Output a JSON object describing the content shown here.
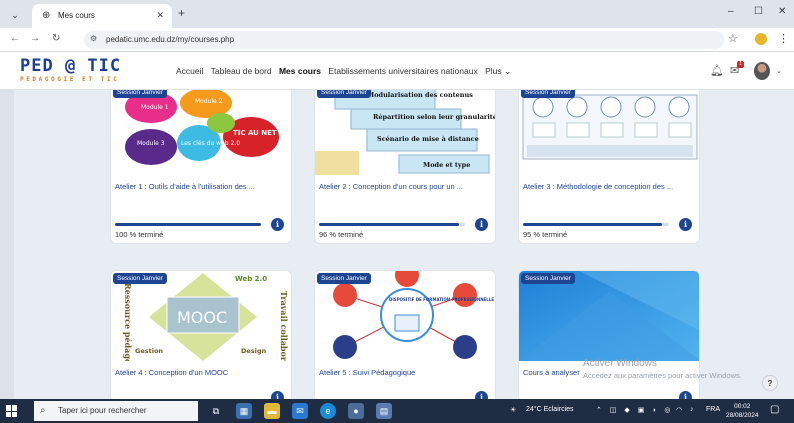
{
  "browser": {
    "tab_title": "Mes cours",
    "url": "pedatic.umc.edu.dz/my/courses.php",
    "new_tab": "+",
    "win_min": "–",
    "win_max": "☐",
    "win_close": "✕"
  },
  "site": {
    "logo_main": "PED @ TIC",
    "logo_sub": "PEDAGOGIE ET TIC",
    "menu": [
      "Accueil",
      "Tableau de bord",
      "Mes cours",
      "Etablissements universitaires nationaux",
      "Plus ⌄"
    ],
    "notif_badge": "1"
  },
  "courses": [
    {
      "session": "Session Janvier",
      "title": "Atelier 1 : Outils d'aide à l'utilisation des ...",
      "progress": 100,
      "progress_label": "100 % terminé"
    },
    {
      "session": "Session Janvier",
      "title": "Atelier 2 : Conception d'un cours pour un ...",
      "progress": 96,
      "progress_label": "96 % terminé"
    },
    {
      "session": "Session Janvier",
      "title": "Atelier 3 : Méthodologie de conception des ...",
      "progress": 95,
      "progress_label": "95 % terminé"
    },
    {
      "session": "Session Janvier",
      "title": "Atelier 4 : Conception d'un MOOC",
      "progress": null,
      "progress_label": ""
    },
    {
      "session": "Session Janvier",
      "title": "Atelier 5 : Suivi Pédagogique",
      "progress": null,
      "progress_label": ""
    },
    {
      "session": "Session Janvier",
      "title": "Cours à analyser",
      "progress": null,
      "progress_label": ""
    }
  ],
  "card_images": {
    "c1": [
      "Module 1",
      "Module 2",
      "Module 3",
      "Les clés du web 2.0",
      "TIC AU NET"
    ],
    "c2": [
      "Modularisation des contenus",
      "Répartition selon leur granularité",
      "Scénario de mise à distance",
      "Mode et type"
    ],
    "c4": [
      "Web 2.0",
      "MOOC",
      "Ressource pédagogique",
      "Travail collaboratif",
      "Gestion",
      "Design"
    ],
    "c5": [
      "DISPOSITIF DE FORMATION PROFESSIONNELLE"
    ]
  },
  "overlay": {
    "activate_title": "Activer Windows",
    "activate_sub": "Accédez aux paramètres pour activer Windows.",
    "help": "?"
  },
  "taskbar": {
    "search_placeholder": "Taper ici pour rechercher",
    "weather": "24°C  Eclaircies",
    "lang": "FRA",
    "time": "00:02",
    "date": "28/08/2024"
  },
  "colors": {
    "brand_blue": "#1e4592",
    "logo_orange": "#d97b1e",
    "taskbar": "#1f2d44"
  }
}
